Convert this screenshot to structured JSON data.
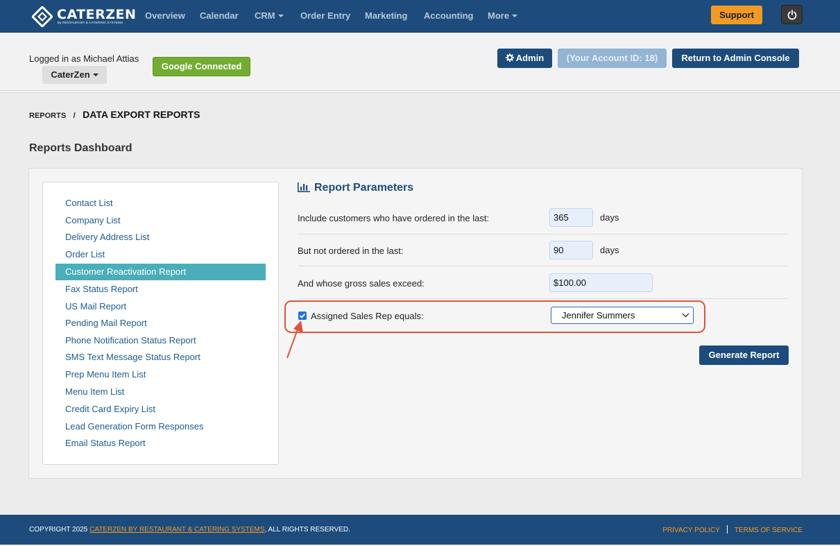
{
  "nav": {
    "logo_text": "CATERZEN",
    "logo_subtext": "By RESTAURANT & CATERING SYSTEMS",
    "items": [
      "Overview",
      "Calendar",
      "CRM",
      "Order Entry",
      "Marketing",
      "Accounting",
      "More"
    ],
    "support_label": "Support",
    "power_icon": "power-icon"
  },
  "account": {
    "logged_in_text": "Logged in as Michael Attias",
    "company_dropdown": "CaterZen",
    "google_label": "Google Connected",
    "admin_label": "Admin",
    "account_id_label": "(Your Account ID: 18)",
    "return_label": "Return to Admin Console"
  },
  "breadcrumb": {
    "parent": "REPORTS",
    "separator": "/",
    "current": "DATA EXPORT REPORTS"
  },
  "dashboard_title": "Reports Dashboard",
  "sidebar": {
    "active_index": 4,
    "items": [
      "Contact List",
      "Company List",
      "Delivery Address List",
      "Order List",
      "Customer Reactivation Report",
      "Fax Status Report",
      "US Mail Report",
      "Pending Mail Report",
      "Phone Notification Status Report",
      "SMS Text Message Status Report",
      "Prep Menu Item List",
      "Menu Item List",
      "Credit Card Expiry List",
      "Lead Generation Form Responses",
      "Email Status Report"
    ]
  },
  "params": {
    "title": "Report Parameters",
    "ordered_last_label": "Include customers who have ordered in the last:",
    "ordered_last_value": "365",
    "not_ordered_label": "But not ordered in the last:",
    "not_ordered_value": "90",
    "days_unit": "days",
    "gross_sales_label": "And whose gross sales exceed:",
    "gross_sales_value": "$100.00",
    "sales_rep_label": "Assigned Sales Rep equals:",
    "sales_rep_checked": true,
    "sales_rep_value": "Jennifer Summers",
    "generate_label": "Generate Report"
  },
  "footer": {
    "copyright_prefix": "COPYRIGHT 2025",
    "company_link": "CATERZEN BY RESTAURANT & CATERING SYSTEMS",
    "copyright_suffix": ", ALL RIGHTS RESERVED.",
    "privacy": "PRIVACY POLICY",
    "terms": "TERMS OF SERVICE"
  },
  "colors": {
    "brand_navy": "#1d4c7c",
    "accent_orange": "#f39a22",
    "active_teal": "#4aaeba",
    "google_green": "#72ad32",
    "highlight_red": "#e0533a"
  }
}
